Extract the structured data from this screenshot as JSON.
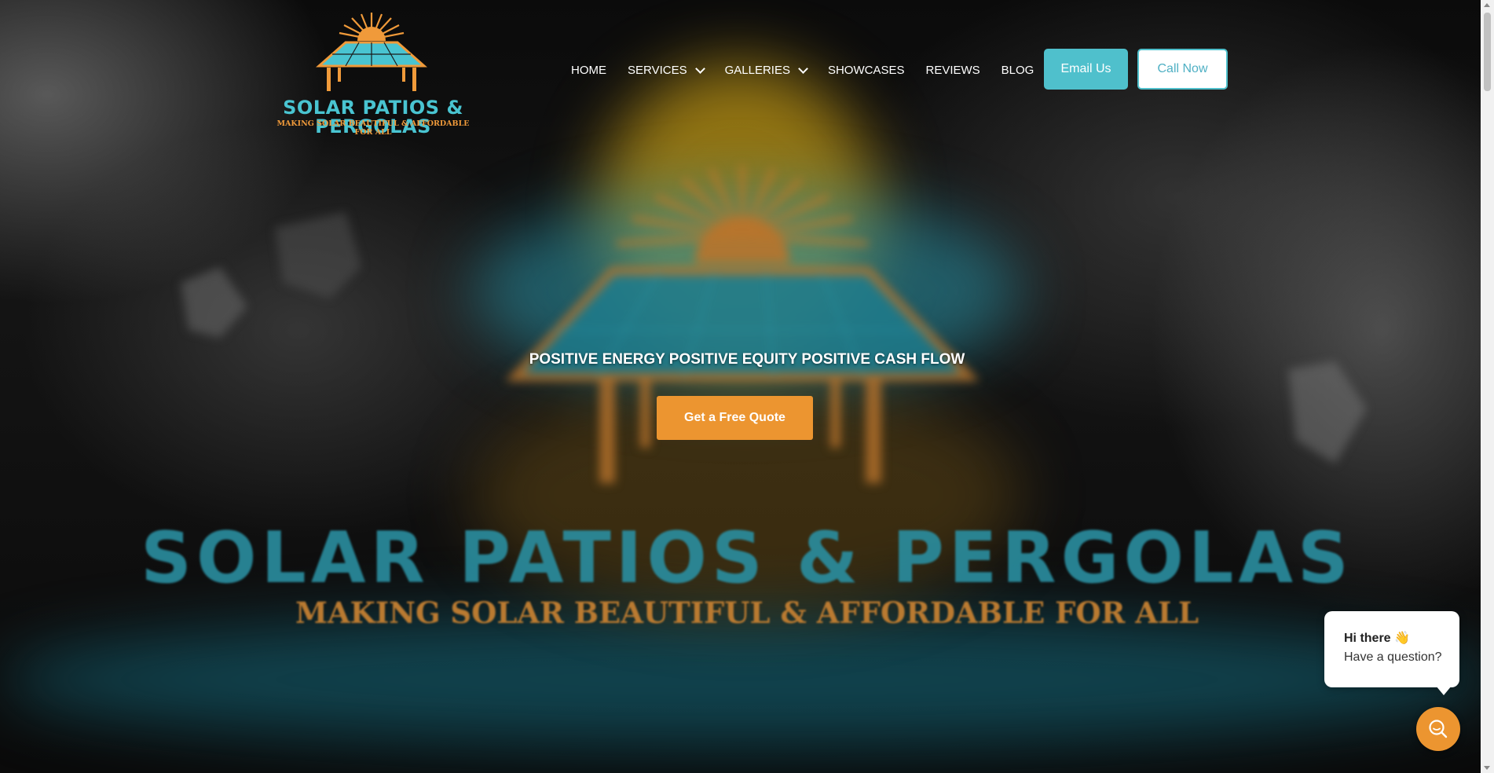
{
  "logo": {
    "wordmark": "SOLAR PATIOS & PERGOLAS",
    "tagline": "MAKING SOLAR BEAUTIFUL & AFFORDABLE FOR ALL"
  },
  "nav": {
    "items": [
      {
        "label": "HOME",
        "has_dropdown": false
      },
      {
        "label": "SERVICES",
        "has_dropdown": true
      },
      {
        "label": "GALLERIES",
        "has_dropdown": true
      },
      {
        "label": "SHOWCASES",
        "has_dropdown": false
      },
      {
        "label": "REVIEWS",
        "has_dropdown": false
      },
      {
        "label": "BLOG",
        "has_dropdown": false
      }
    ]
  },
  "header_buttons": {
    "email_label": "Email Us",
    "call_label": "Call Now"
  },
  "hero": {
    "headline": "POSITIVE ENERGY POSITIVE EQUITY POSITIVE CASH FLOW",
    "cta_label": "Get a Free Quote",
    "big_title": "SOLAR PATIOS & PERGOLAS",
    "big_tagline": "MAKING SOLAR BEAUTIFUL & AFFORDABLE FOR ALL"
  },
  "chat": {
    "greeting": "Hi there 👋",
    "prompt": "Have a question?",
    "button_icon": "chat-search-icon"
  },
  "colors": {
    "accent_teal": "#4fc0cc",
    "accent_orange": "#ec9530",
    "background": "#050505"
  }
}
